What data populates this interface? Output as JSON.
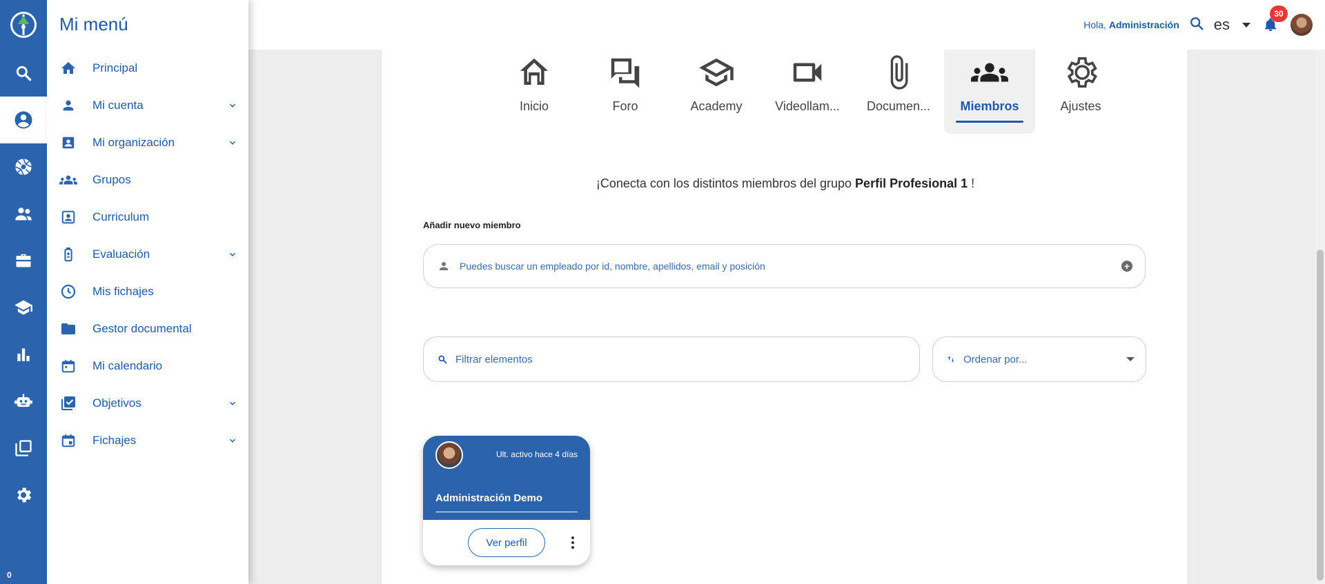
{
  "topbar": {
    "greeting": "Hola,",
    "user": "Administración",
    "language": "es",
    "notifications_count": "30"
  },
  "menu": {
    "title": "Mi menú",
    "items": [
      {
        "label": "Principal",
        "icon": "home-icon",
        "expandable": false
      },
      {
        "label": "Mi cuenta",
        "icon": "person-icon",
        "expandable": true
      },
      {
        "label": "Mi organización",
        "icon": "contact-card-icon",
        "expandable": true
      },
      {
        "label": "Grupos",
        "icon": "groups-icon",
        "expandable": false
      },
      {
        "label": "Curriculum",
        "icon": "portrait-icon",
        "expandable": false
      },
      {
        "label": "Evaluación",
        "icon": "evaluation-icon",
        "expandable": true
      },
      {
        "label": "Mis fichajes",
        "icon": "clock-icon",
        "expandable": false
      },
      {
        "label": "Gestor documental",
        "icon": "folder-icon",
        "expandable": false
      },
      {
        "label": "Mi calendario",
        "icon": "calendar-icon",
        "expandable": false
      },
      {
        "label": "Objetivos",
        "icon": "checklist-icon",
        "expandable": true
      },
      {
        "label": "Fichajes",
        "icon": "event-icon",
        "expandable": true
      }
    ]
  },
  "rail": {
    "counter": "0"
  },
  "tabs": [
    {
      "label": "Inicio",
      "icon": "home-outline-icon"
    },
    {
      "label": "Foro",
      "icon": "forum-icon"
    },
    {
      "label": "Academy",
      "icon": "school-icon"
    },
    {
      "label": "Videollam...",
      "icon": "videocam-icon"
    },
    {
      "label": "Documen...",
      "icon": "attachment-icon"
    },
    {
      "label": "Miembros",
      "icon": "groups-icon",
      "active": true
    },
    {
      "label": "Ajustes",
      "icon": "settings-icon"
    }
  ],
  "members": {
    "intro_prefix": "¡Conecta con los distintos miembros del grupo",
    "group_name": "Perfil Profesional 1",
    "intro_suffix": "!",
    "add_label": "Añadir nuevo miembro",
    "add_placeholder": "Puedes buscar un empleado por id, nombre, apellidos, email y posición",
    "filter_placeholder": "Filtrar elementos",
    "sort_placeholder": "Ordenar por..."
  },
  "card": {
    "status": "Ult. activo hace 4 días",
    "name": "Administración Demo",
    "button": "Ver perfil"
  },
  "colors": {
    "primary": "#2b63ad",
    "text_blue": "#1e5aa8",
    "badge": "#e53935"
  }
}
